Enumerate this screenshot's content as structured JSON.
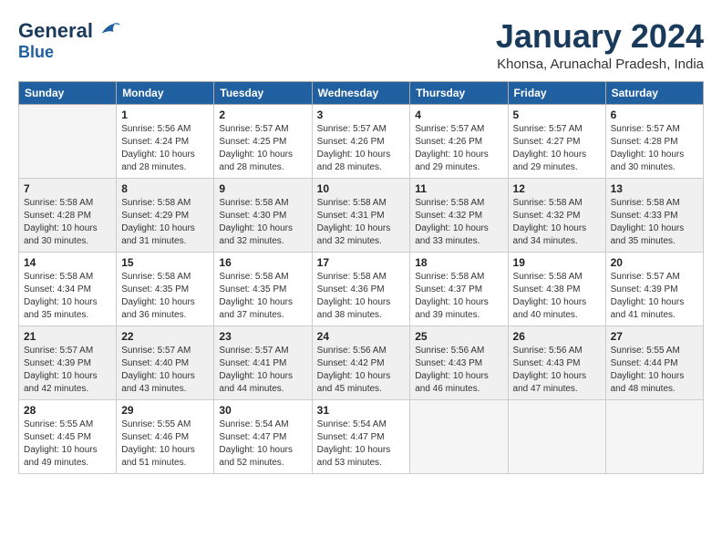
{
  "header": {
    "logo_line1": "General",
    "logo_line2": "Blue",
    "month_title": "January 2024",
    "subtitle": "Khonsa, Arunachal Pradesh, India"
  },
  "days_of_week": [
    "Sunday",
    "Monday",
    "Tuesday",
    "Wednesday",
    "Thursday",
    "Friday",
    "Saturday"
  ],
  "weeks": [
    [
      {
        "day": "",
        "info": ""
      },
      {
        "day": "1",
        "info": "Sunrise: 5:56 AM\nSunset: 4:24 PM\nDaylight: 10 hours\nand 28 minutes."
      },
      {
        "day": "2",
        "info": "Sunrise: 5:57 AM\nSunset: 4:25 PM\nDaylight: 10 hours\nand 28 minutes."
      },
      {
        "day": "3",
        "info": "Sunrise: 5:57 AM\nSunset: 4:26 PM\nDaylight: 10 hours\nand 28 minutes."
      },
      {
        "day": "4",
        "info": "Sunrise: 5:57 AM\nSunset: 4:26 PM\nDaylight: 10 hours\nand 29 minutes."
      },
      {
        "day": "5",
        "info": "Sunrise: 5:57 AM\nSunset: 4:27 PM\nDaylight: 10 hours\nand 29 minutes."
      },
      {
        "day": "6",
        "info": "Sunrise: 5:57 AM\nSunset: 4:28 PM\nDaylight: 10 hours\nand 30 minutes."
      }
    ],
    [
      {
        "day": "7",
        "info": "Sunrise: 5:58 AM\nSunset: 4:28 PM\nDaylight: 10 hours\nand 30 minutes."
      },
      {
        "day": "8",
        "info": "Sunrise: 5:58 AM\nSunset: 4:29 PM\nDaylight: 10 hours\nand 31 minutes."
      },
      {
        "day": "9",
        "info": "Sunrise: 5:58 AM\nSunset: 4:30 PM\nDaylight: 10 hours\nand 32 minutes."
      },
      {
        "day": "10",
        "info": "Sunrise: 5:58 AM\nSunset: 4:31 PM\nDaylight: 10 hours\nand 32 minutes."
      },
      {
        "day": "11",
        "info": "Sunrise: 5:58 AM\nSunset: 4:32 PM\nDaylight: 10 hours\nand 33 minutes."
      },
      {
        "day": "12",
        "info": "Sunrise: 5:58 AM\nSunset: 4:32 PM\nDaylight: 10 hours\nand 34 minutes."
      },
      {
        "day": "13",
        "info": "Sunrise: 5:58 AM\nSunset: 4:33 PM\nDaylight: 10 hours\nand 35 minutes."
      }
    ],
    [
      {
        "day": "14",
        "info": "Sunrise: 5:58 AM\nSunset: 4:34 PM\nDaylight: 10 hours\nand 35 minutes."
      },
      {
        "day": "15",
        "info": "Sunrise: 5:58 AM\nSunset: 4:35 PM\nDaylight: 10 hours\nand 36 minutes."
      },
      {
        "day": "16",
        "info": "Sunrise: 5:58 AM\nSunset: 4:35 PM\nDaylight: 10 hours\nand 37 minutes."
      },
      {
        "day": "17",
        "info": "Sunrise: 5:58 AM\nSunset: 4:36 PM\nDaylight: 10 hours\nand 38 minutes."
      },
      {
        "day": "18",
        "info": "Sunrise: 5:58 AM\nSunset: 4:37 PM\nDaylight: 10 hours\nand 39 minutes."
      },
      {
        "day": "19",
        "info": "Sunrise: 5:58 AM\nSunset: 4:38 PM\nDaylight: 10 hours\nand 40 minutes."
      },
      {
        "day": "20",
        "info": "Sunrise: 5:57 AM\nSunset: 4:39 PM\nDaylight: 10 hours\nand 41 minutes."
      }
    ],
    [
      {
        "day": "21",
        "info": "Sunrise: 5:57 AM\nSunset: 4:39 PM\nDaylight: 10 hours\nand 42 minutes."
      },
      {
        "day": "22",
        "info": "Sunrise: 5:57 AM\nSunset: 4:40 PM\nDaylight: 10 hours\nand 43 minutes."
      },
      {
        "day": "23",
        "info": "Sunrise: 5:57 AM\nSunset: 4:41 PM\nDaylight: 10 hours\nand 44 minutes."
      },
      {
        "day": "24",
        "info": "Sunrise: 5:56 AM\nSunset: 4:42 PM\nDaylight: 10 hours\nand 45 minutes."
      },
      {
        "day": "25",
        "info": "Sunrise: 5:56 AM\nSunset: 4:43 PM\nDaylight: 10 hours\nand 46 minutes."
      },
      {
        "day": "26",
        "info": "Sunrise: 5:56 AM\nSunset: 4:43 PM\nDaylight: 10 hours\nand 47 minutes."
      },
      {
        "day": "27",
        "info": "Sunrise: 5:55 AM\nSunset: 4:44 PM\nDaylight: 10 hours\nand 48 minutes."
      }
    ],
    [
      {
        "day": "28",
        "info": "Sunrise: 5:55 AM\nSunset: 4:45 PM\nDaylight: 10 hours\nand 49 minutes."
      },
      {
        "day": "29",
        "info": "Sunrise: 5:55 AM\nSunset: 4:46 PM\nDaylight: 10 hours\nand 51 minutes."
      },
      {
        "day": "30",
        "info": "Sunrise: 5:54 AM\nSunset: 4:47 PM\nDaylight: 10 hours\nand 52 minutes."
      },
      {
        "day": "31",
        "info": "Sunrise: 5:54 AM\nSunset: 4:47 PM\nDaylight: 10 hours\nand 53 minutes."
      },
      {
        "day": "",
        "info": ""
      },
      {
        "day": "",
        "info": ""
      },
      {
        "day": "",
        "info": ""
      }
    ]
  ],
  "shaded_rows": [
    1,
    3
  ]
}
